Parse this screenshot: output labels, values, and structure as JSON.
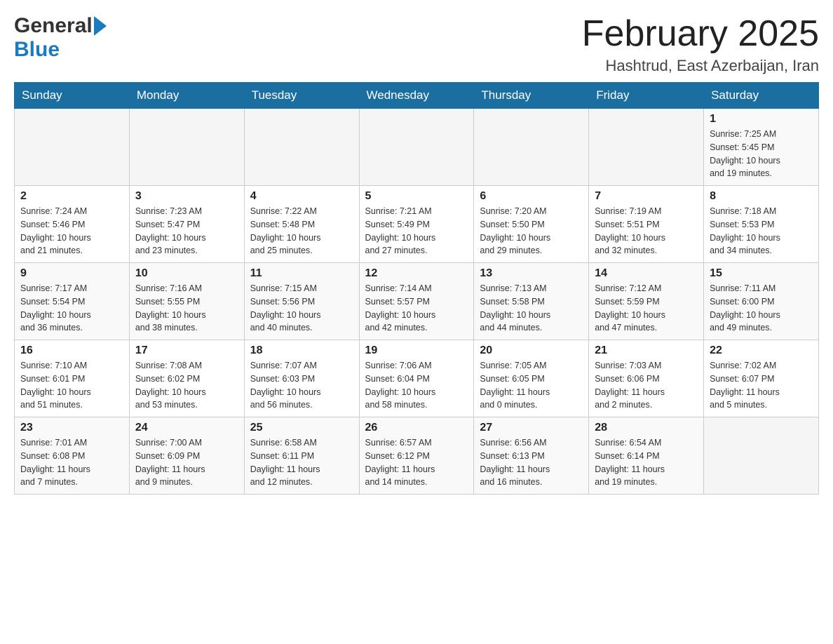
{
  "header": {
    "logo_general": "General",
    "logo_blue": "Blue",
    "title": "February 2025",
    "location": "Hashtrud, East Azerbaijan, Iran"
  },
  "weekdays": [
    "Sunday",
    "Monday",
    "Tuesday",
    "Wednesday",
    "Thursday",
    "Friday",
    "Saturday"
  ],
  "weeks": [
    [
      {
        "day": "",
        "info": ""
      },
      {
        "day": "",
        "info": ""
      },
      {
        "day": "",
        "info": ""
      },
      {
        "day": "",
        "info": ""
      },
      {
        "day": "",
        "info": ""
      },
      {
        "day": "",
        "info": ""
      },
      {
        "day": "1",
        "info": "Sunrise: 7:25 AM\nSunset: 5:45 PM\nDaylight: 10 hours\nand 19 minutes."
      }
    ],
    [
      {
        "day": "2",
        "info": "Sunrise: 7:24 AM\nSunset: 5:46 PM\nDaylight: 10 hours\nand 21 minutes."
      },
      {
        "day": "3",
        "info": "Sunrise: 7:23 AM\nSunset: 5:47 PM\nDaylight: 10 hours\nand 23 minutes."
      },
      {
        "day": "4",
        "info": "Sunrise: 7:22 AM\nSunset: 5:48 PM\nDaylight: 10 hours\nand 25 minutes."
      },
      {
        "day": "5",
        "info": "Sunrise: 7:21 AM\nSunset: 5:49 PM\nDaylight: 10 hours\nand 27 minutes."
      },
      {
        "day": "6",
        "info": "Sunrise: 7:20 AM\nSunset: 5:50 PM\nDaylight: 10 hours\nand 29 minutes."
      },
      {
        "day": "7",
        "info": "Sunrise: 7:19 AM\nSunset: 5:51 PM\nDaylight: 10 hours\nand 32 minutes."
      },
      {
        "day": "8",
        "info": "Sunrise: 7:18 AM\nSunset: 5:53 PM\nDaylight: 10 hours\nand 34 minutes."
      }
    ],
    [
      {
        "day": "9",
        "info": "Sunrise: 7:17 AM\nSunset: 5:54 PM\nDaylight: 10 hours\nand 36 minutes."
      },
      {
        "day": "10",
        "info": "Sunrise: 7:16 AM\nSunset: 5:55 PM\nDaylight: 10 hours\nand 38 minutes."
      },
      {
        "day": "11",
        "info": "Sunrise: 7:15 AM\nSunset: 5:56 PM\nDaylight: 10 hours\nand 40 minutes."
      },
      {
        "day": "12",
        "info": "Sunrise: 7:14 AM\nSunset: 5:57 PM\nDaylight: 10 hours\nand 42 minutes."
      },
      {
        "day": "13",
        "info": "Sunrise: 7:13 AM\nSunset: 5:58 PM\nDaylight: 10 hours\nand 44 minutes."
      },
      {
        "day": "14",
        "info": "Sunrise: 7:12 AM\nSunset: 5:59 PM\nDaylight: 10 hours\nand 47 minutes."
      },
      {
        "day": "15",
        "info": "Sunrise: 7:11 AM\nSunset: 6:00 PM\nDaylight: 10 hours\nand 49 minutes."
      }
    ],
    [
      {
        "day": "16",
        "info": "Sunrise: 7:10 AM\nSunset: 6:01 PM\nDaylight: 10 hours\nand 51 minutes."
      },
      {
        "day": "17",
        "info": "Sunrise: 7:08 AM\nSunset: 6:02 PM\nDaylight: 10 hours\nand 53 minutes."
      },
      {
        "day": "18",
        "info": "Sunrise: 7:07 AM\nSunset: 6:03 PM\nDaylight: 10 hours\nand 56 minutes."
      },
      {
        "day": "19",
        "info": "Sunrise: 7:06 AM\nSunset: 6:04 PM\nDaylight: 10 hours\nand 58 minutes."
      },
      {
        "day": "20",
        "info": "Sunrise: 7:05 AM\nSunset: 6:05 PM\nDaylight: 11 hours\nand 0 minutes."
      },
      {
        "day": "21",
        "info": "Sunrise: 7:03 AM\nSunset: 6:06 PM\nDaylight: 11 hours\nand 2 minutes."
      },
      {
        "day": "22",
        "info": "Sunrise: 7:02 AM\nSunset: 6:07 PM\nDaylight: 11 hours\nand 5 minutes."
      }
    ],
    [
      {
        "day": "23",
        "info": "Sunrise: 7:01 AM\nSunset: 6:08 PM\nDaylight: 11 hours\nand 7 minutes."
      },
      {
        "day": "24",
        "info": "Sunrise: 7:00 AM\nSunset: 6:09 PM\nDaylight: 11 hours\nand 9 minutes."
      },
      {
        "day": "25",
        "info": "Sunrise: 6:58 AM\nSunset: 6:11 PM\nDaylight: 11 hours\nand 12 minutes."
      },
      {
        "day": "26",
        "info": "Sunrise: 6:57 AM\nSunset: 6:12 PM\nDaylight: 11 hours\nand 14 minutes."
      },
      {
        "day": "27",
        "info": "Sunrise: 6:56 AM\nSunset: 6:13 PM\nDaylight: 11 hours\nand 16 minutes."
      },
      {
        "day": "28",
        "info": "Sunrise: 6:54 AM\nSunset: 6:14 PM\nDaylight: 11 hours\nand 19 minutes."
      },
      {
        "day": "",
        "info": ""
      }
    ]
  ]
}
